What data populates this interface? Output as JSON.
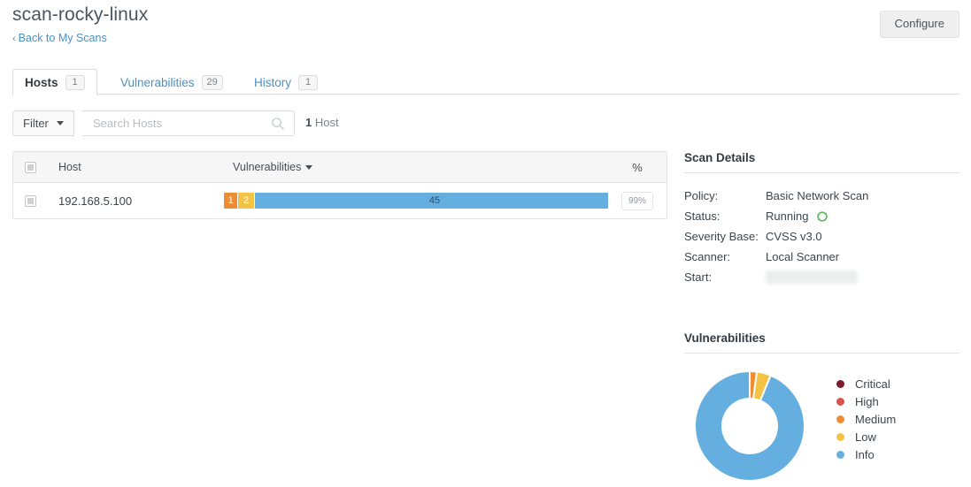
{
  "header": {
    "scan_title": "scan-rocky-linux",
    "back_link": "Back to My Scans",
    "back_chevron": "‹",
    "configure_label": "Configure"
  },
  "tabs": [
    {
      "label": "Hosts",
      "count": "1",
      "active": true
    },
    {
      "label": "Vulnerabilities",
      "count": "29",
      "active": false
    },
    {
      "label": "History",
      "count": "1",
      "active": false
    }
  ],
  "toolbar": {
    "filter_label": "Filter",
    "search_placeholder": "Search Hosts",
    "search_value": "",
    "host_count_number": "1",
    "host_count_label": "Host"
  },
  "hosts_table": {
    "columns": {
      "host": "Host",
      "vulnerabilities": "Vulnerabilities",
      "sort_indicator": "▾",
      "percent": "%"
    },
    "rows": [
      {
        "host": "192.168.5.100",
        "percent": "99%",
        "segments": [
          {
            "severity": "Medium",
            "count": "1",
            "value": 1,
            "color": "#ee8c34"
          },
          {
            "severity": "Low",
            "count": "2",
            "value": 2,
            "color": "#f5c344"
          },
          {
            "severity": "Info",
            "count": "45",
            "value": 45,
            "color": "#65aee0"
          }
        ]
      }
    ]
  },
  "scan_details": {
    "heading": "Scan Details",
    "rows": [
      {
        "label": "Policy:",
        "value": "Basic Network Scan",
        "type": "text"
      },
      {
        "label": "Status:",
        "value": "Running",
        "type": "status"
      },
      {
        "label": "Severity Base:",
        "value": "CVSS v3.0",
        "type": "text"
      },
      {
        "label": "Scanner:",
        "value": "Local Scanner",
        "type": "text"
      },
      {
        "label": "Start:",
        "value": "",
        "type": "redacted"
      }
    ],
    "status_icon_color": "#5cb85c"
  },
  "vulnerabilities_panel": {
    "heading": "Vulnerabilities",
    "legend": [
      {
        "label": "Critical",
        "color": "#7c1a2e"
      },
      {
        "label": "High",
        "color": "#d9534f"
      },
      {
        "label": "Medium",
        "color": "#ee8c34"
      },
      {
        "label": "Low",
        "color": "#f5c344"
      },
      {
        "label": "Info",
        "color": "#65aee0"
      }
    ]
  },
  "chart_data": {
    "type": "pie",
    "title": "Vulnerabilities",
    "variant": "donut",
    "categories": [
      "Critical",
      "High",
      "Medium",
      "Low",
      "Info"
    ],
    "values": [
      0,
      0,
      1,
      2,
      45
    ],
    "colors": [
      "#7c1a2e",
      "#d9534f",
      "#ee8c34",
      "#f5c344",
      "#65aee0"
    ],
    "total": 48,
    "legend_position": "right",
    "labels_shown": false
  }
}
